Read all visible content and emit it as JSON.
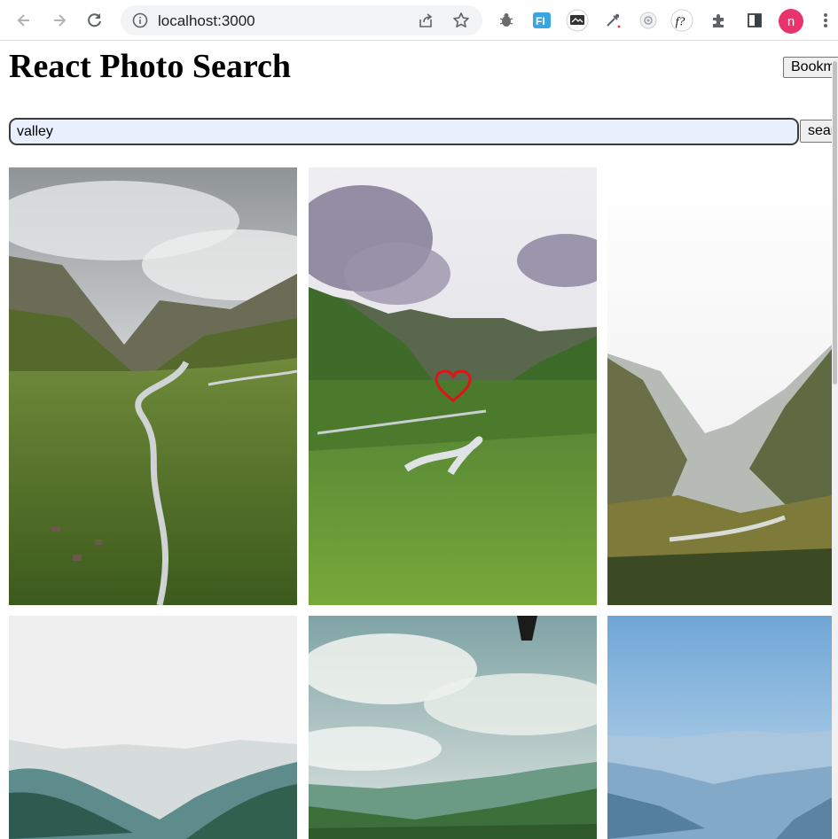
{
  "browser": {
    "url": "localhost:3000",
    "profile_initial": "n",
    "profile_color": "#e8336d",
    "extensions": [
      "bug-icon",
      "fi-extension-icon",
      "screen-extension-icon",
      "eyedropper-icon",
      "face-extension-icon",
      "font-ninja-icon",
      "puzzle-icon",
      "side-panel-icon"
    ]
  },
  "app": {
    "title": "React Photo Search",
    "bookmark_label": "Bookmarks",
    "search": {
      "value": "valley",
      "button_label": "search"
    }
  },
  "photos": [
    {
      "alt": "Valley with river and clouds",
      "favorited": false
    },
    {
      "alt": "Green valley with stream and sunrays",
      "favorited": true
    },
    {
      "alt": "Misty canyon valley with river",
      "favorited": false
    },
    {
      "alt": "Hazy mountain valley",
      "favorited": false
    },
    {
      "alt": "Valley under cloudy sky",
      "favorited": false
    },
    {
      "alt": "Blue hazy mountains",
      "favorited": false
    }
  ],
  "colors": {
    "favorite_heart": "#e01414",
    "input_bg": "#e8f0fe"
  }
}
